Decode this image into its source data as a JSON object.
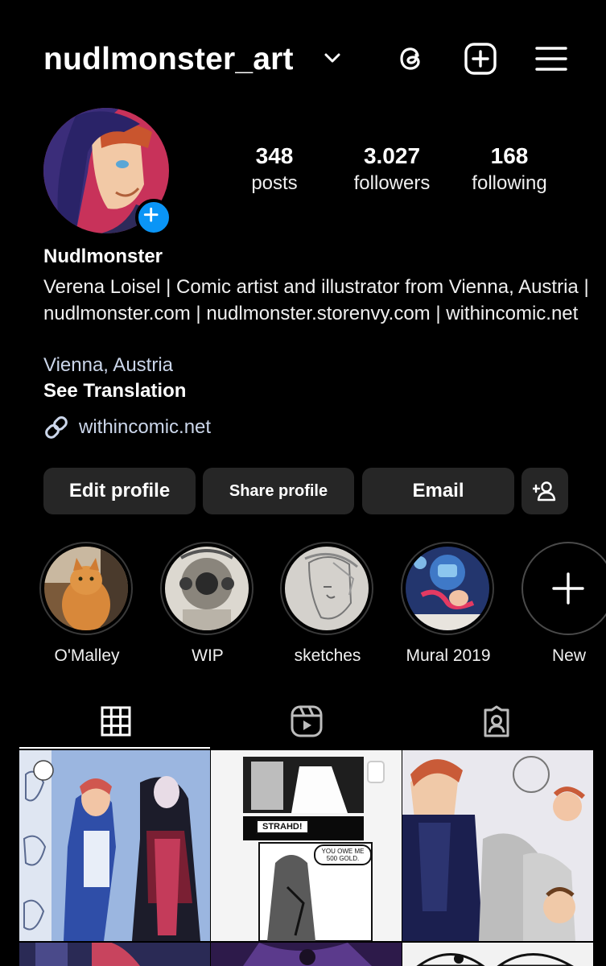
{
  "header": {
    "username": "nudlmonster_art"
  },
  "profile": {
    "stats": [
      {
        "value": "348",
        "label": "posts"
      },
      {
        "value": "3.027",
        "label": "followers"
      },
      {
        "value": "168",
        "label": "following"
      }
    ],
    "name": "Nudlmonster",
    "bio": "Verena Loisel | Comic artist and illustrator from Vienna, Austria | nudlmonster.com | nudlmonster.storenvy.com | withincomic.net",
    "location": "Vienna, Austria",
    "translate": "See Translation",
    "link": "withincomic.net"
  },
  "buttons": {
    "edit": "Edit profile",
    "share": "Share profile",
    "email": "Email"
  },
  "highlights": [
    {
      "label": "O'Malley"
    },
    {
      "label": "WIP"
    },
    {
      "label": "sketches"
    },
    {
      "label": "Mural 2019"
    },
    {
      "label": "New"
    }
  ],
  "posts": {
    "panel1_text": "STRAHD!",
    "panel2_text": "YOU OWE ME 500 GOLD."
  },
  "colors": {
    "accent": "#0a95f6",
    "button_bg": "#262626",
    "link": "#cbd6ea"
  },
  "icons": [
    "chevron-down-icon",
    "threads-icon",
    "add-post-icon",
    "menu-icon",
    "link-icon",
    "add-person-icon",
    "plus-icon",
    "grid-icon",
    "reels-icon",
    "tagged-icon"
  ]
}
